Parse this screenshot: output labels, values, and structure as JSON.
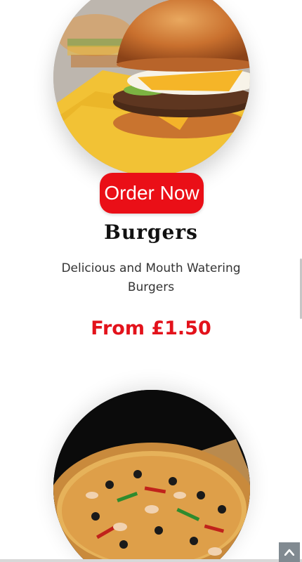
{
  "menu_items": [
    {
      "photo_icon": "burger-photo",
      "order_label": "Order Now",
      "title": "Burgers",
      "description": "Delicious and Mouth Watering Burgers",
      "price": "From £1.50"
    },
    {
      "photo_icon": "pizza-photo"
    }
  ],
  "scroll_top": {
    "icon": "chevron-up-icon"
  },
  "colors": {
    "accent": "#ea0f17",
    "price": "#e3121b",
    "title": "#111111",
    "scroll_button": "#818a91"
  }
}
